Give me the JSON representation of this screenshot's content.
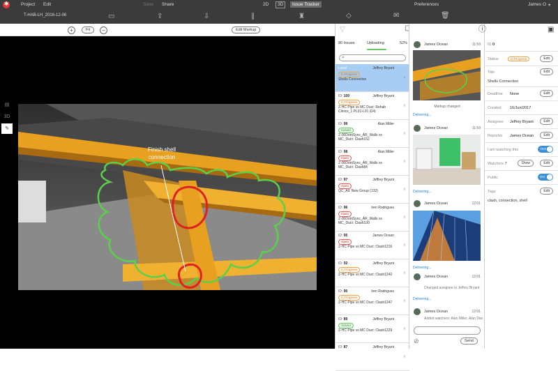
{
  "menu": {
    "project": "Project",
    "edit": "Edit",
    "save": "Save",
    "share": "Share",
    "mode_2d": "2D",
    "mode_3d": "3D",
    "issue_tracker": "Issue Tracker",
    "preferences": "Preferences",
    "user": "James O"
  },
  "file_name": "T-HAB-LH_2016-12-06",
  "view": {
    "fit": "Fit",
    "edit_markup": "Edit Markup",
    "annotation": "Finish shell connection"
  },
  "issues_panel": {
    "tab_issues": "80 Issues",
    "tab_uploading": "Uploading",
    "percent": "52%",
    "items": [
      {
        "id": "Local",
        "who": "Jeffrey Bryant",
        "status": "In Progress",
        "status_type": "prog",
        "desc": "Shells Connection",
        "local": true
      },
      {
        "id": "100",
        "who": "Jeffrey Bryant",
        "status": "In Progress",
        "status_type": "prog",
        "desc": "Z-HC Pipe vs MC Duct: Rehab Clinics_1 PL01-L01 (04)"
      },
      {
        "id": "99",
        "who": "Alan Miller",
        "status": "Solved",
        "status_type": "solved",
        "desc": "Z-00DontSync_AR_Walls vs MC_Duct: Clash152"
      },
      {
        "id": "98",
        "who": "Alan Miller",
        "status": "Open",
        "status_type": "open",
        "desc": "Z-00DontSync_AR_Walls vs MC_Duct: Clash84"
      },
      {
        "id": "97",
        "who": "Jeffrey Bryant",
        "status": "Open",
        "status_type": "open",
        "desc": "QC_All: New Group (132)"
      },
      {
        "id": "96",
        "who": "Iren Rodrigues",
        "status": "Open",
        "status_type": "open",
        "desc": "Z-00DontSync_AR_Walls vs MC_Duct: Clash100"
      },
      {
        "id": "95",
        "who": "James Ocean",
        "status": "Open",
        "status_type": "open",
        "desc": "Z-HC Pipe vs MC Duct: Clash1216"
      },
      {
        "id": "92",
        "who": "Jeffrey Bryant",
        "status": "In Progress",
        "status_type": "prog",
        "desc": "Z-HC Pipe vs MC Duct: Clash1242"
      },
      {
        "id": "90",
        "who": "Iren Rodrigues",
        "status": "In Progress",
        "status_type": "prog",
        "desc": "Z-HC Pipe vs MC Duct: Clash1247"
      },
      {
        "id": "89",
        "who": "Jeffrey Bryant",
        "status": "Solved",
        "status_type": "solved",
        "desc": "Z-HC Pipe vs MC Duct: Clash1229"
      },
      {
        "id": "87",
        "who": "Jeffrey Bryant",
        "status": "",
        "status_type": "",
        "desc": ""
      }
    ]
  },
  "chat": {
    "messages": [
      {
        "user": "James Ocean",
        "time": "11:59",
        "caption": "Markup changed",
        "delivery": "Delivering..."
      },
      {
        "user": "James Ocean",
        "time": "11:59",
        "delivery": "Delivering..."
      },
      {
        "user": "James Ocean",
        "time": "12:01",
        "delivery": "Delivering..."
      },
      {
        "user": "James Ocean",
        "time": "12:01",
        "note": "Changed assignee to Jeffrey Bryant",
        "delivery": "Delivering..."
      },
      {
        "user": "James Ocean",
        "time": "12:01",
        "note": "Added watchers: Alan Miller, Alan Diamond, Iren Rodrigues, Eugen..."
      }
    ],
    "send": "Send"
  },
  "props": {
    "id_label": "ID",
    "id_value": "0",
    "status_label": "Status",
    "status_value": "In Progress",
    "title_label": "Title",
    "title_value": "Shells Connection",
    "deadline_label": "Deadline",
    "deadline_value": "None",
    "created_label": "Created",
    "created_value": "16/Jun/2017",
    "assignee_label": "Assignee",
    "assignee_value": "Jeffrey Bryant",
    "reporter_label": "Reporter",
    "reporter_value": "James Ocean",
    "watching_label": "I am watching this",
    "watching_value": "YES",
    "watchers_label": "Watchers",
    "watchers_value": "7",
    "show": "Show",
    "public_label": "Public",
    "public_value": "ON",
    "tags_label": "Tags",
    "tags_value": "clash, connection, shell",
    "edit": "Edit"
  }
}
